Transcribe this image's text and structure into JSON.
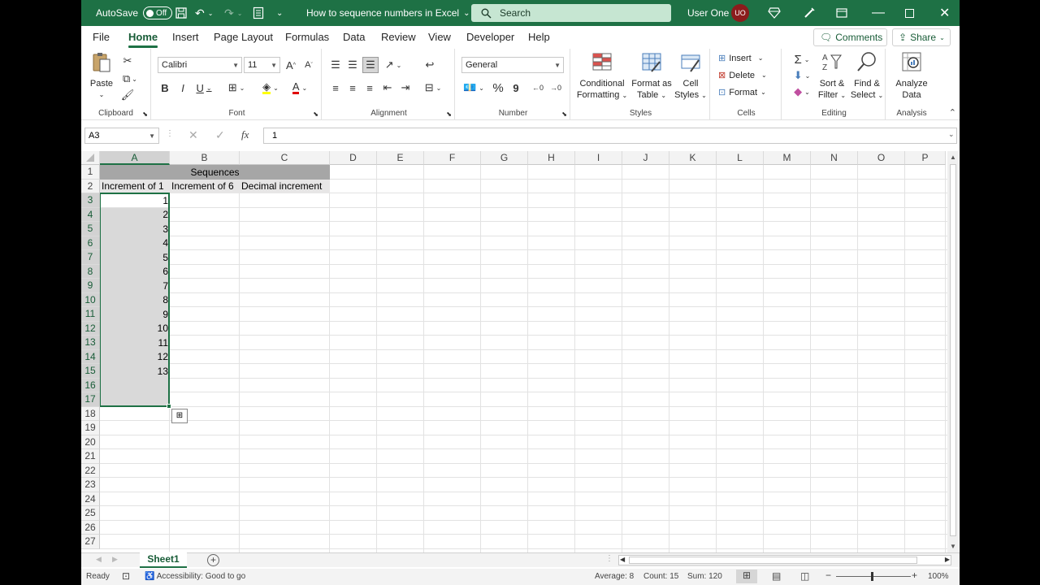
{
  "titlebar": {
    "autosave_label": "AutoSave",
    "autosave_state": "Off",
    "doc_title": "How to sequence numbers in Excel",
    "search_placeholder": "Search",
    "user_name": "User One",
    "user_initials": "UO"
  },
  "tabs": [
    {
      "label": "File"
    },
    {
      "label": "Home"
    },
    {
      "label": "Insert"
    },
    {
      "label": "Page Layout"
    },
    {
      "label": "Formulas"
    },
    {
      "label": "Data"
    },
    {
      "label": "Review"
    },
    {
      "label": "View"
    },
    {
      "label": "Developer"
    },
    {
      "label": "Help"
    }
  ],
  "active_tab": "Home",
  "comments_label": "Comments",
  "share_label": "Share",
  "ribbon": {
    "clipboard": {
      "paste_label": "Paste",
      "group_label": "Clipboard"
    },
    "font": {
      "family": "Calibri",
      "size": "11",
      "group_label": "Font",
      "grow": "A",
      "shrink": "A",
      "bold": "B",
      "italic": "I",
      "underline": "U"
    },
    "alignment": {
      "group_label": "Alignment"
    },
    "number": {
      "format": "General",
      "percent": "%",
      "comma": "9",
      "group_label": "Number"
    },
    "styles": {
      "conditional_l1": "Conditional",
      "conditional_l2": "Formatting",
      "table_l1": "Format as",
      "table_l2": "Table",
      "cell_l1": "Cell",
      "cell_l2": "Styles",
      "group_label": "Styles"
    },
    "cells": {
      "insert": "Insert",
      "delete": "Delete",
      "format": "Format",
      "group_label": "Cells"
    },
    "editing": {
      "sort_l1": "Sort &",
      "sort_l2": "Filter",
      "find_l1": "Find &",
      "find_l2": "Select",
      "group_label": "Editing"
    },
    "analysis": {
      "analyze_l1": "Analyze",
      "analyze_l2": "Data",
      "group_label": "Analysis"
    }
  },
  "formula_bar": {
    "name_box": "A3",
    "content": "1",
    "fx": "fx"
  },
  "columns": [
    "A",
    "B",
    "C",
    "D",
    "E",
    "F",
    "G",
    "H",
    "I",
    "J",
    "K",
    "L",
    "M",
    "N",
    "O",
    "P"
  ],
  "rows": [
    "1",
    "2",
    "3",
    "4",
    "5",
    "6",
    "7",
    "8",
    "9",
    "10",
    "11",
    "12",
    "13",
    "14",
    "15",
    "16",
    "17",
    "18",
    "19",
    "20",
    "21",
    "22",
    "23",
    "24",
    "25",
    "26",
    "27"
  ],
  "sheet": {
    "title_cell": "Sequences",
    "headers": [
      "Increment of 1",
      "Increment of 6",
      "Decimal increment"
    ],
    "col_a_values": [
      "1",
      "2",
      "3",
      "4",
      "5",
      "6",
      "7",
      "8",
      "9",
      "10",
      "11",
      "12",
      "13"
    ]
  },
  "sheet_tabs": {
    "active": "Sheet1"
  },
  "status": {
    "ready": "Ready",
    "accessibility": "Accessibility: Good to go",
    "average": "Average: 8",
    "count": "Count: 15",
    "sum": "Sum: 120",
    "zoom": "100%"
  },
  "colors": {
    "accent": "#1e7145",
    "header_fill": "#a6a6a6",
    "selection_fill": "#d9d9d9"
  }
}
